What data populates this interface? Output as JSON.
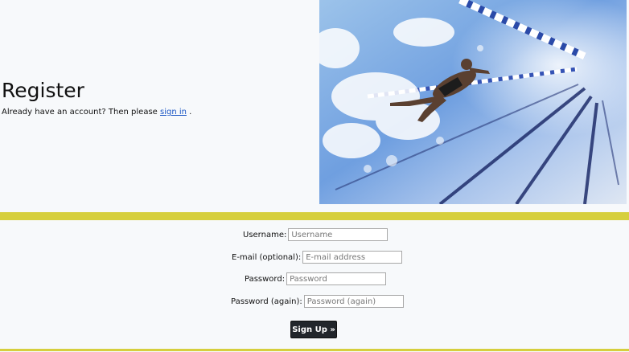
{
  "header": {
    "title": "Register",
    "subtitle_prefix": "Already have an account? Then please ",
    "signin_link": "sign in",
    "subtitle_suffix": " ."
  },
  "hero": {
    "description": "swimmer-underwater-pool-photo"
  },
  "form": {
    "username": {
      "label": "Username:",
      "placeholder": "Username",
      "value": ""
    },
    "email": {
      "label": "E-mail (optional):",
      "placeholder": "E-mail address",
      "value": ""
    },
    "password": {
      "label": "Password:",
      "placeholder": "Password",
      "value": ""
    },
    "password_again": {
      "label": "Password (again):",
      "placeholder": "Password (again)",
      "value": ""
    },
    "submit_label": "Sign Up »"
  },
  "colors": {
    "divider": "#d6cf3d",
    "button": "#22262b",
    "link": "#1a55c4",
    "background": "#f7f9fb"
  }
}
